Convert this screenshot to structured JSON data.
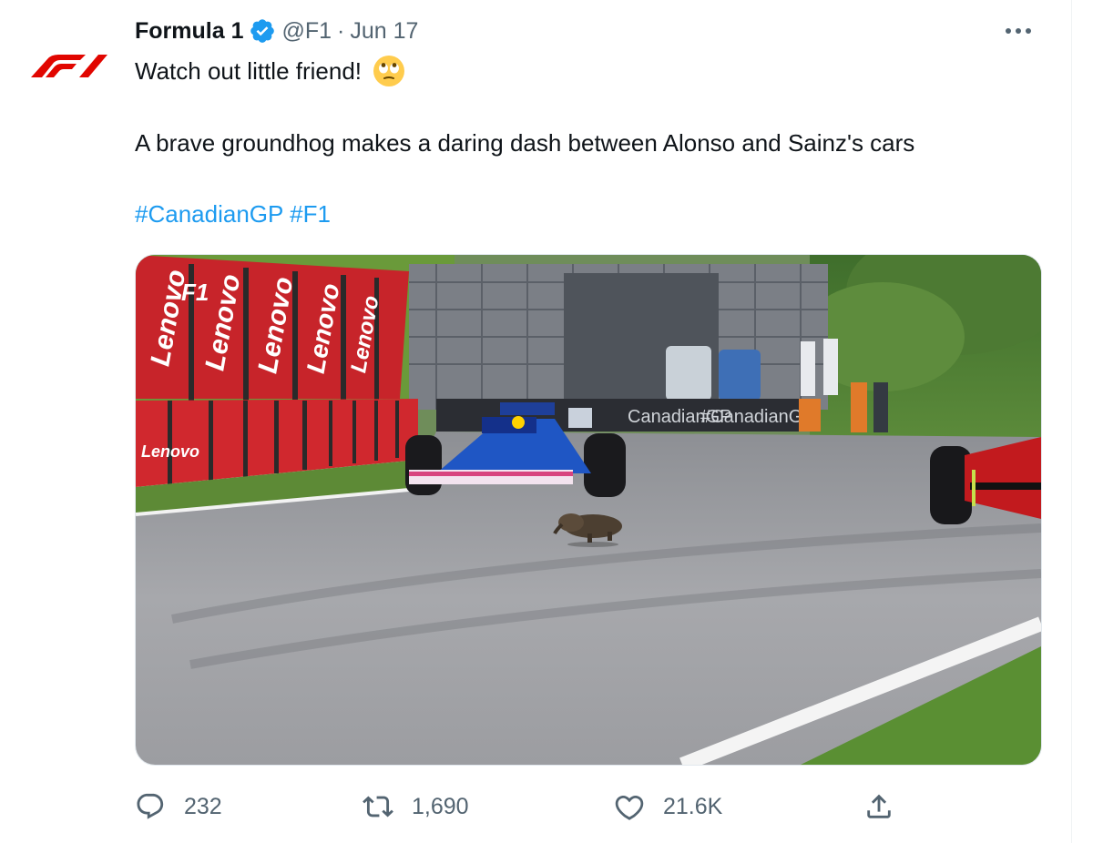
{
  "tweet": {
    "display_name": "Formula 1",
    "handle": "@F1",
    "separator": "·",
    "date": "Jun 17",
    "line1": "Watch out little friend!",
    "line2": "A brave groundhog makes a daring dash between Alonso and Sainz's cars",
    "hashtags": [
      "#CanadianGP",
      "#F1"
    ]
  },
  "media": {
    "fence_banners": [
      "Lenovo",
      "Lenovo",
      "Lenovo",
      "Lenovo",
      "Lenovo",
      "Lenovo"
    ],
    "f1_logo": "F1",
    "barrier_text": [
      "CanadianGP",
      "#CanadianGP"
    ]
  },
  "metrics": {
    "replies": "232",
    "retweets": "1,690",
    "likes": "21.6K"
  },
  "icons": {
    "avatar": "f1-logo-icon",
    "verified": "verified-badge-icon",
    "emoji": "rolling-eyes-emoji-icon",
    "more": "more-options-icon",
    "reply": "reply-icon",
    "retweet": "retweet-icon",
    "like": "like-icon",
    "share": "share-icon"
  },
  "colors": {
    "hashtag": "#1d9bf0",
    "verified": "#1d9bf0",
    "brand_red": "#e10600",
    "secondary_text": "#536471"
  }
}
